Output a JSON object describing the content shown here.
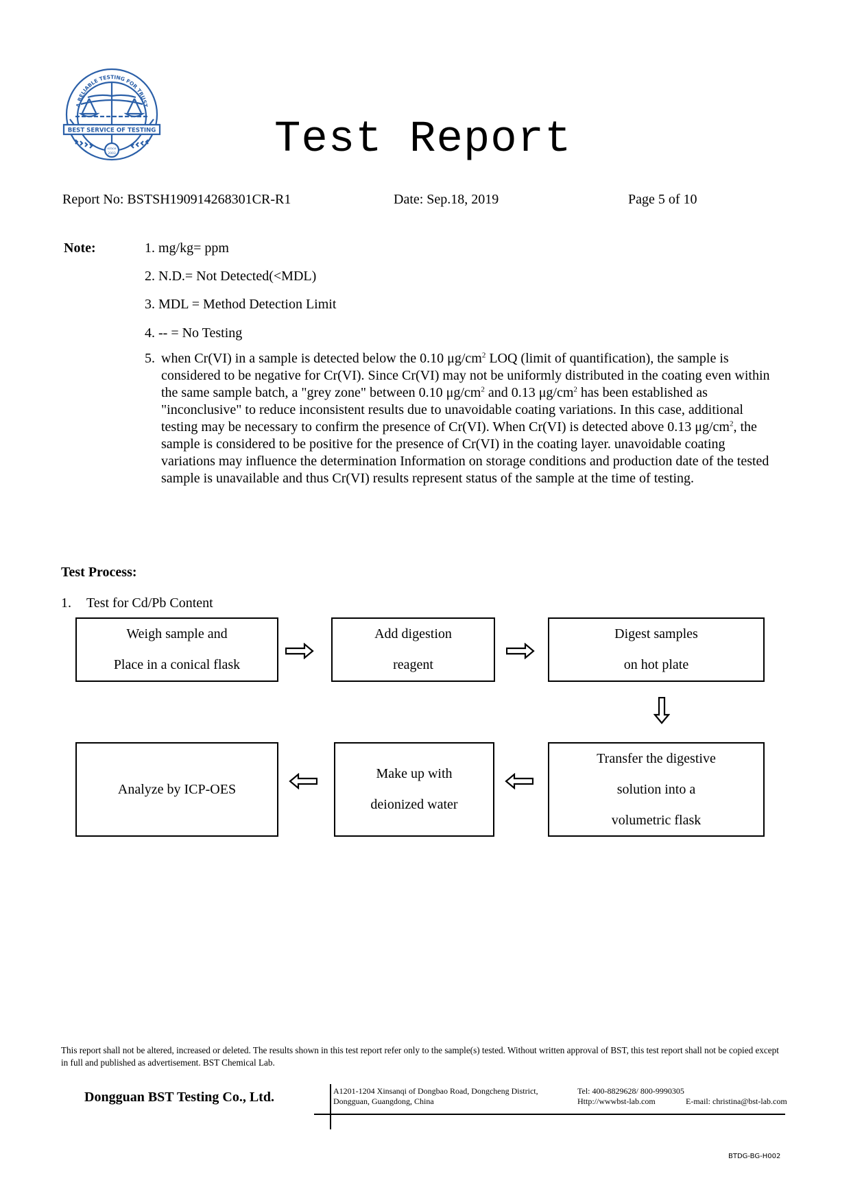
{
  "logo": {
    "arc_text": "A RELIABLE TESTING FOR TRUST",
    "banner_text": "BEST SERVICE OF TESTING",
    "since_label": "since",
    "since_year": "2003",
    "color": "#2a5fa8"
  },
  "title": "Test Report",
  "header": {
    "report_no": "Report No: BSTSH190914268301CR-R1",
    "date": "Date: Sep.18, 2019",
    "page": "Page 5 of 10"
  },
  "notes": {
    "label": "Note:",
    "items": [
      "1. mg/kg= ppm",
      "2. N.D.= Not Detected(<MDL)",
      "3. MDL = Method Detection Limit",
      "4. -- = No Testing"
    ],
    "item5": {
      "num": "5.",
      "t1": "when Cr(VI) in a sample is detected below the 0.10 μg/cm",
      "sup1": "2",
      "t2": " LOQ (limit of quantification), the sample is considered to be negative for Cr(VI). Since Cr(VI) may not be uniformly distributed in the coating even within the same sample batch, a \"grey zone\" between 0.10 μg/cm",
      "sup2": "2",
      "t3": " and 0.13 μg/cm",
      "sup3": "2",
      "t4": " has been established as \"inconclusive\" to reduce inconsistent results due to unavoidable coating variations. In this case, additional testing may be necessary to confirm the presence of Cr(VI). When Cr(VI) is detected above 0.13 μg/cm",
      "sup4": "2",
      "t5": ", the sample is considered to be positive for the presence of Cr(VI) in the coating layer. unavoidable coating variations may influence the determination Information on storage conditions and production date of the tested sample is unavailable and thus Cr(VI) results represent status of the sample at the time of testing."
    }
  },
  "test_process": {
    "label": "Test Process:",
    "step_number": "1.",
    "step_title": "Test for Cd/Pb Content",
    "flow": [
      {
        "lines": [
          "Weigh sample and",
          "Place in a conical flask"
        ]
      },
      {
        "lines": [
          "Add digestion",
          "reagent"
        ]
      },
      {
        "lines": [
          "Digest samples",
          "on hot plate"
        ]
      },
      {
        "lines": [
          "Transfer the digestive",
          "solution into a",
          "volumetric flask"
        ]
      },
      {
        "lines": [
          "Make up with",
          "deionized water"
        ]
      },
      {
        "lines": [
          "Analyze by ICP-OES"
        ]
      }
    ],
    "arrows": [
      "right-arrow",
      "right-arrow",
      "down-arrow",
      "left-arrow",
      "left-arrow"
    ]
  },
  "footer": {
    "disclaimer": "This report shall not be altered, increased or deleted. The results shown in this test report refer only to the sample(s) tested. Without written approval of BST, this test report shall not be copied except in full and published as advertisement. BST Chemical Lab.",
    "company": "Dongguan BST Testing Co., Ltd.",
    "address_line1": "A1201-1204 Xinsanqi of Dongbao Road, Dongcheng District,",
    "address_line2": "Dongguan, Guangdong, China",
    "tel": "Tel: 400-8829628/ 800-9990305",
    "website": "Http://wwwbst-lab.com",
    "email": "E-mail: christina@bst-lab.com",
    "form_code": "BTDG-BG-H002"
  }
}
